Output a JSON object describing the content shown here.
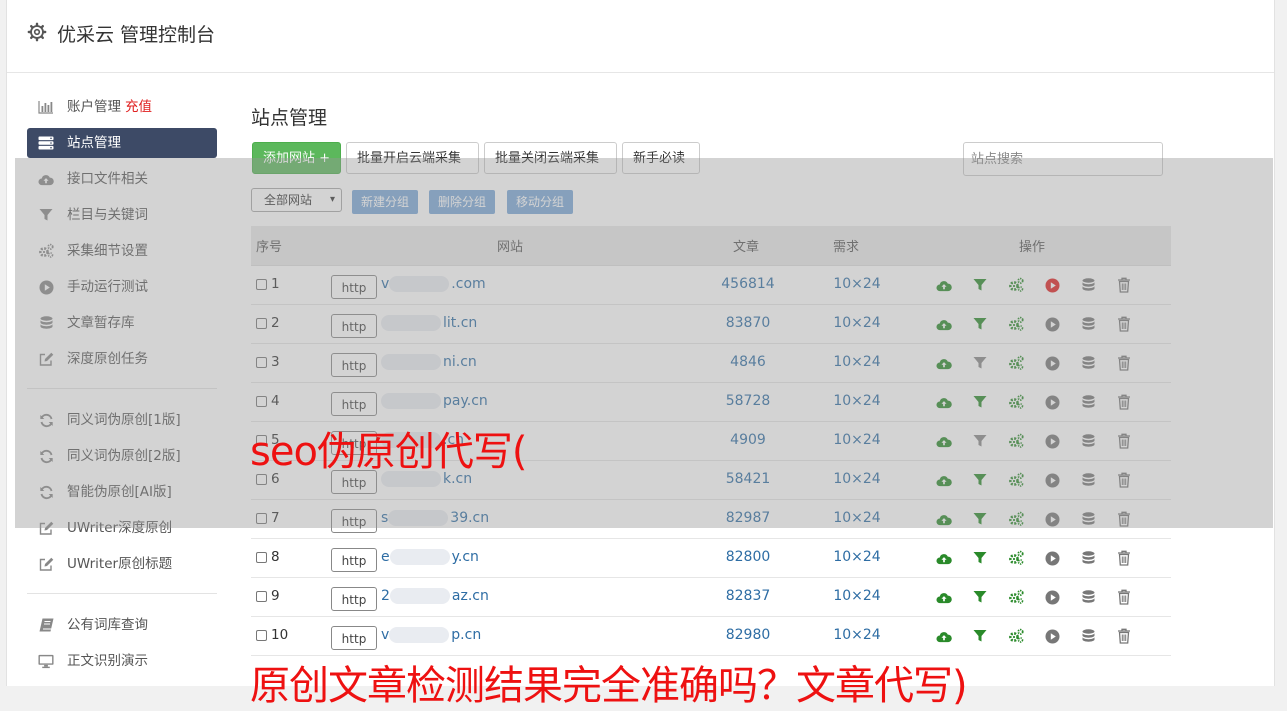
{
  "header": {
    "title": "优采云 管理控制台"
  },
  "sidebar": {
    "groups": [
      [
        {
          "label": "账户管理",
          "extra": "充值",
          "icon": "bar-chart-icon"
        },
        {
          "label": "站点管理",
          "icon": "server-icon",
          "active": true
        },
        {
          "label": "接口文件相关",
          "icon": "cloud-upload-icon"
        },
        {
          "label": "栏目与关键词",
          "icon": "filter-icon"
        },
        {
          "label": "采集细节设置",
          "icon": "gears-icon"
        },
        {
          "label": "手动运行测试",
          "icon": "play-circle-icon"
        },
        {
          "label": "文章暂存库",
          "icon": "database-icon"
        },
        {
          "label": "深度原创任务",
          "icon": "edit-icon"
        }
      ],
      [
        {
          "label": "同义词伪原创[1版]",
          "icon": "refresh-icon"
        },
        {
          "label": "同义词伪原创[2版]",
          "icon": "refresh-icon"
        },
        {
          "label": "智能伪原创[AI版]",
          "icon": "refresh-icon"
        },
        {
          "label": "UWriter深度原创",
          "icon": "edit-icon"
        },
        {
          "label": "UWriter原创标题",
          "icon": "edit-icon"
        }
      ],
      [
        {
          "label": "公有词库查询",
          "icon": "book-icon"
        },
        {
          "label": "正文识别演示",
          "icon": "monitor-icon"
        }
      ]
    ]
  },
  "main": {
    "title": "站点管理",
    "toolbar": {
      "add_site": "添加网站 +",
      "batch_open": "批量开启云端采集",
      "batch_close": "批量关闭云端采集",
      "guide": "新手必读",
      "search_placeholder": "站点搜索"
    },
    "group_bar": {
      "select_value": "全部网站",
      "new_group": "新建分组",
      "delete_group": "删除分组",
      "move_group": "移动分组"
    },
    "table": {
      "columns": [
        "序号",
        "网站",
        "文章",
        "需求",
        "操作"
      ],
      "http_label": "http",
      "rows": [
        {
          "idx": "1",
          "site_prefix": "v",
          "site": ".com",
          "articles": "456814",
          "need": "10×24",
          "run_active": true,
          "filter_green": true
        },
        {
          "idx": "2",
          "site_prefix": "",
          "site": "lit.cn",
          "articles": "83870",
          "need": "10×24",
          "run_active": false,
          "filter_green": true
        },
        {
          "idx": "3",
          "site_prefix": "",
          "site": "ni.cn",
          "articles": "4846",
          "need": "10×24",
          "run_active": false,
          "filter_green": false
        },
        {
          "idx": "4",
          "site_prefix": "",
          "site": "pay.cn",
          "articles": "58728",
          "need": "10×24",
          "run_active": false,
          "filter_green": true
        },
        {
          "idx": "5",
          "site_prefix": "",
          "site": ".cn",
          "articles": "4909",
          "need": "10×24",
          "run_active": false,
          "filter_green": false
        },
        {
          "idx": "6",
          "site_prefix": "",
          "site": "k.cn",
          "articles": "58421",
          "need": "10×24",
          "run_active": false,
          "filter_green": true
        },
        {
          "idx": "7",
          "site_prefix": "s",
          "site": "39.cn",
          "articles": "82987",
          "need": "10×24",
          "run_active": false,
          "filter_green": true
        },
        {
          "idx": "8",
          "site_prefix": "e",
          "site": "y.cn",
          "articles": "82800",
          "need": "10×24",
          "run_active": false,
          "filter_green": true
        },
        {
          "idx": "9",
          "site_prefix": "2",
          "site": "az.cn",
          "articles": "82837",
          "need": "10×24",
          "run_active": false,
          "filter_green": true
        },
        {
          "idx": "10",
          "site_prefix": "v",
          "site": "p.cn",
          "articles": "82980",
          "need": "10×24",
          "run_active": false,
          "filter_green": true
        }
      ]
    }
  },
  "watermarks": {
    "line1": "seo伪原创代写(",
    "line2": "原创文章检测结果完全准确吗？文章代写)"
  },
  "colors": {
    "active_nav": "#3d4a66",
    "add_button": "#5cb85c",
    "group_buttons": "#7ba8d8",
    "link": "#2e6da4",
    "watermark": "#ee1111",
    "icon_green": "#2a8a2a",
    "icon_red": "#e02020"
  }
}
